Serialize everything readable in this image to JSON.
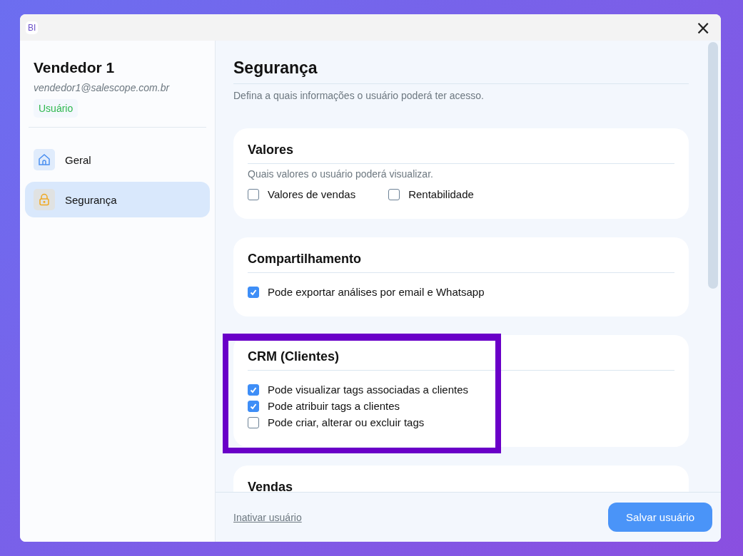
{
  "window": {
    "logo": "BI",
    "close": "×"
  },
  "user": {
    "name": "Vendedor 1",
    "email": "vendedor1@salescope.com.br",
    "role": "Usuário"
  },
  "sidebar": {
    "items": [
      {
        "label": "Geral",
        "kind": "home",
        "selected": false
      },
      {
        "label": "Segurança",
        "kind": "lock",
        "selected": true
      }
    ]
  },
  "page": {
    "title": "Segurança",
    "subtitle": "Defina a quais informações o usuário poderá ter acesso."
  },
  "sections": [
    {
      "title": "Valores",
      "description": "Quais valores o usuário poderá visualizar.",
      "kind": "inline",
      "options": [
        {
          "label": "Valores de vendas",
          "checked": false
        },
        {
          "label": "Rentabilidade",
          "checked": false
        }
      ]
    },
    {
      "title": "Compartilhamento",
      "kind": "list",
      "options": [
        {
          "label": "Pode exportar análises por email e Whatsapp",
          "checked": true
        }
      ]
    },
    {
      "title": "CRM (Clientes)",
      "kind": "list",
      "highlighted": true,
      "options": [
        {
          "label": "Pode visualizar tags associadas a clientes",
          "checked": true
        },
        {
          "label": "Pode atribuir tags a clientes",
          "checked": true
        },
        {
          "label": "Pode criar, alterar ou excluir tags",
          "checked": false
        }
      ]
    },
    {
      "title": "Vendas"
    }
  ],
  "footer": {
    "link": "Inativar usuário",
    "button": "Salvar usuário"
  }
}
